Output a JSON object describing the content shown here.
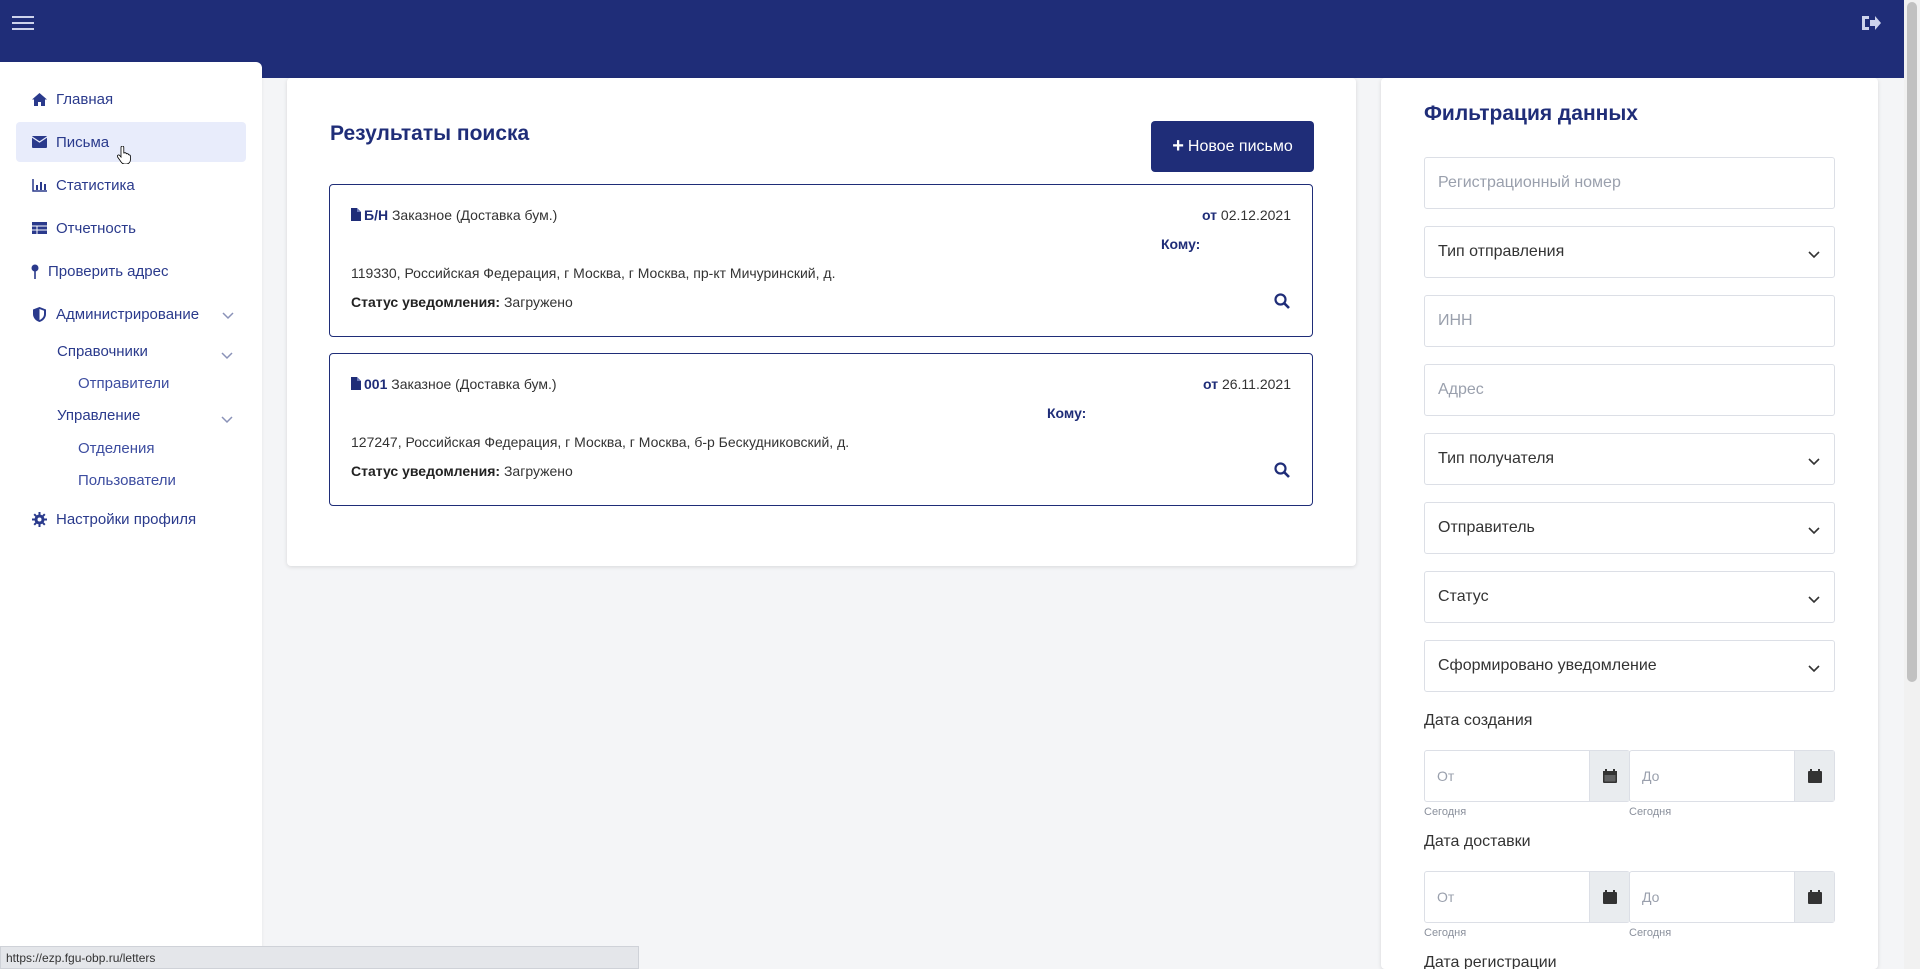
{
  "sidebar": {
    "items": [
      {
        "label": "Главная",
        "icon": "home-icon"
      },
      {
        "label": "Письма",
        "icon": "envelope-icon"
      },
      {
        "label": "Статистика",
        "icon": "bar-chart-icon"
      },
      {
        "label": "Отчетность",
        "icon": "table-icon"
      },
      {
        "label": "Проверить адрес",
        "icon": "map-pin-icon"
      },
      {
        "label": "Администрирование",
        "icon": "shield-icon"
      },
      {
        "label": "Настройки профиля",
        "icon": "gear-icon"
      }
    ],
    "sub": {
      "directories": "Справочники",
      "senders": "Отправители",
      "management": "Управление",
      "departments": "Отделения",
      "users": "Пользователи"
    }
  },
  "results": {
    "title": "Результаты поиска",
    "new_button": "Новое письмо",
    "letters": [
      {
        "number": "Б/Н",
        "type": "Заказное (Доставка бум.)",
        "date_prefix": "от",
        "date": "02.12.2021",
        "to_label": "Кому:",
        "address": "119330, Российская Федерация, г Москва, г Москва, пр-кт Мичуринский, д.",
        "status_label": "Статус уведомления:",
        "status": "Загружено"
      },
      {
        "number": "001",
        "type": "Заказное (Доставка бум.)",
        "date_prefix": "от",
        "date": "26.11.2021",
        "to_label": "Кому:",
        "address": "127247, Российская Федерация, г Москва, г Москва, б-р Бескудниковский, д.",
        "status_label": "Статус уведомления:",
        "status": "Загружено"
      }
    ]
  },
  "filter": {
    "title": "Фильтрация данных",
    "reg_number_placeholder": "Регистрационный номер",
    "send_type": "Тип отправления",
    "inn_placeholder": "ИНН",
    "address_placeholder": "Адрес",
    "recipient_type": "Тип получателя",
    "sender": "Отправитель",
    "status": "Статус",
    "notification": "Сформировано уведомление",
    "created_label": "Дата создания",
    "delivered_label": "Дата доставки",
    "registered_label": "Дата регистрации",
    "from_placeholder": "От",
    "to_placeholder": "До",
    "today_hint": "Сегодня"
  },
  "statusbar": {
    "url": "https://ezp.fgu-obp.ru/letters"
  },
  "colors": {
    "brand": "#1f2d78",
    "active_bg": "#e8ecfb"
  }
}
